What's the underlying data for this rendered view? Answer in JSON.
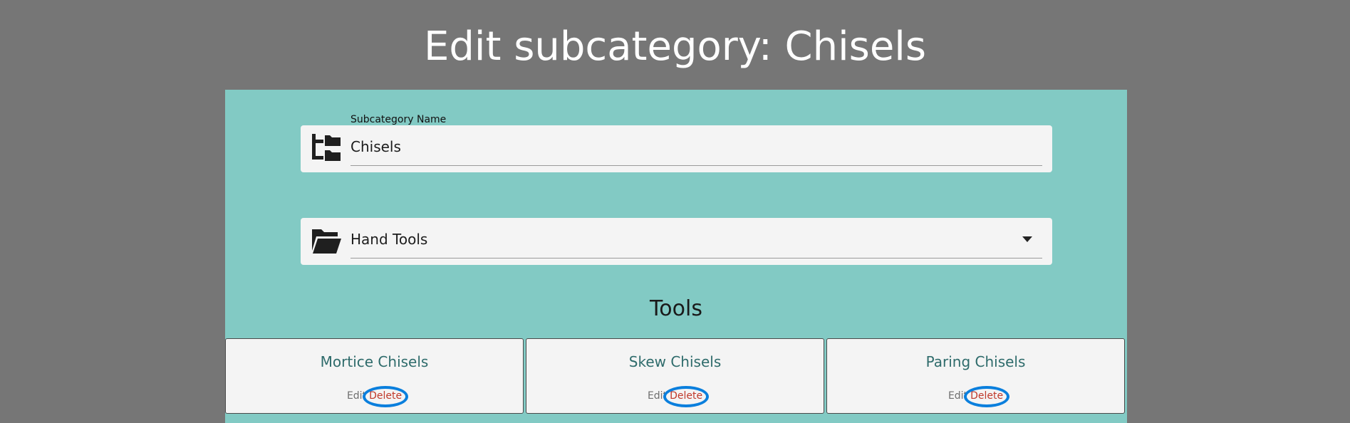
{
  "page": {
    "title": "Edit subcategory: Chisels"
  },
  "form": {
    "name_label": "Subcategory Name",
    "name_value": "Chisels",
    "name_icon": "subcategory-tree-icon",
    "category_value": "Hand Tools",
    "category_icon": "folder-open-icon"
  },
  "tools": {
    "heading": "Tools",
    "items": [
      {
        "name": "Mortice Chisels",
        "edit_label": "Edit",
        "delete_label": "Delete"
      },
      {
        "name": "Skew Chisels",
        "edit_label": "Edit",
        "delete_label": "Delete"
      },
      {
        "name": "Paring Chisels",
        "edit_label": "Edit",
        "delete_label": "Delete"
      }
    ]
  },
  "colors": {
    "page_background": "#767676",
    "panel_background": "#82cac4",
    "field_background": "#f4f4f4",
    "tool_title": "#2e6b6b",
    "delete_link": "#c0392b",
    "annotation_circle": "#0a7fdd"
  }
}
